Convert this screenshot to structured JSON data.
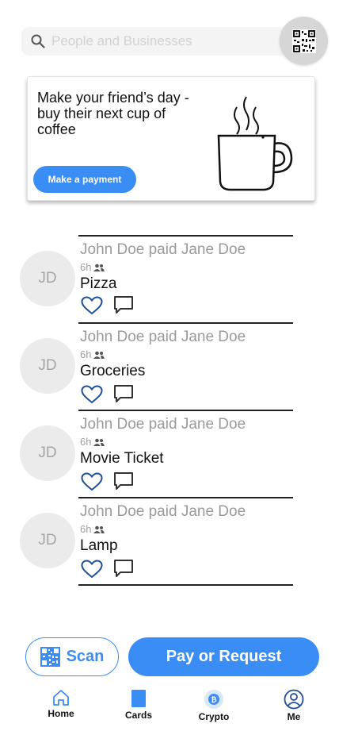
{
  "search": {
    "placeholder": "People and Businesses"
  },
  "promo": {
    "text": "Make your friend’s day - buy their next cup of coffee",
    "button_label": "Make a payment"
  },
  "feed": [
    {
      "initials": "JD",
      "title": "John Doe paid Jane Doe",
      "time": "6h",
      "description": "Pizza"
    },
    {
      "initials": "JD",
      "title": "John Doe paid Jane Doe",
      "time": "6h",
      "description": "Groceries"
    },
    {
      "initials": "JD",
      "title": "John Doe paid Jane Doe",
      "time": "6h",
      "description": "Movie Ticket"
    },
    {
      "initials": "JD",
      "title": "John Doe paid Jane Doe",
      "time": "6h",
      "description": "Lamp"
    }
  ],
  "actions": {
    "scan_label": "Scan",
    "pay_label": "Pay or Request"
  },
  "tabs": [
    {
      "label": "Home",
      "icon": "home-icon"
    },
    {
      "label": "Cards",
      "icon": "card-icon"
    },
    {
      "label": "Crypto",
      "icon": "bitcoin-icon"
    },
    {
      "label": "Me",
      "icon": "user-icon"
    }
  ],
  "colors": {
    "accent": "#3b8df6",
    "heart": "#1f4e9c",
    "avatar_bg": "#ebebeb"
  }
}
